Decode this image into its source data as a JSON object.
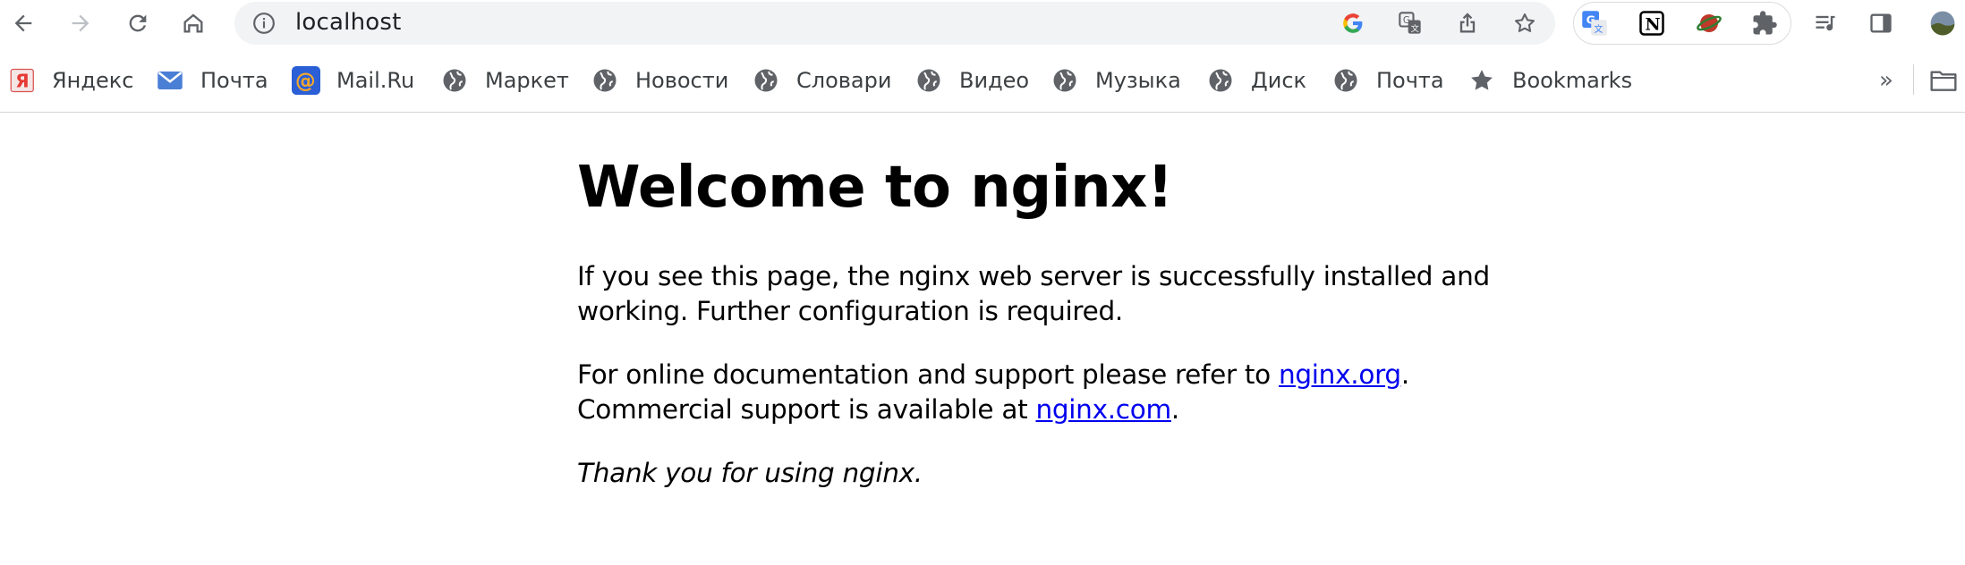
{
  "browser": {
    "url": "localhost",
    "toolbar_icons": [
      "back-icon",
      "forward-icon",
      "reload-icon",
      "home-icon"
    ],
    "omnibox_icons": [
      "site-info-icon",
      "google-icon",
      "translate-icon",
      "share-icon",
      "star-icon"
    ],
    "extensions": [
      "google-translate-icon",
      "notion-icon",
      "planet-icon",
      "puzzle-icon"
    ],
    "right_icons": [
      "reading-list-icon",
      "side-panel-icon",
      "profile-avatar"
    ]
  },
  "bookmarks": {
    "items": [
      {
        "label": "Яндекс",
        "icon": "yandex-icon"
      },
      {
        "label": "Почта",
        "icon": "mail-envelope-icon"
      },
      {
        "label": "Mail.Ru",
        "icon": "mailru-at-icon"
      },
      {
        "label": "Маркет",
        "icon": "globe-icon"
      },
      {
        "label": "Новости",
        "icon": "globe-icon"
      },
      {
        "label": "Словари",
        "icon": "globe-icon"
      },
      {
        "label": "Видео",
        "icon": "globe-icon"
      },
      {
        "label": "Музыка",
        "icon": "globe-icon"
      },
      {
        "label": "Диск",
        "icon": "globe-icon"
      },
      {
        "label": "Почта",
        "icon": "globe-icon"
      },
      {
        "label": "Bookmarks",
        "icon": "star-icon"
      }
    ],
    "overflow": "»",
    "other_folder_icon": "folder-icon"
  },
  "page": {
    "heading": "Welcome to nginx!",
    "p1": "If you see this page, the nginx web server is successfully installed and working. Further configuration is required.",
    "p2_prefix": "For online documentation and support please refer to ",
    "p2_link1": "nginx.org",
    "p2_mid": ".",
    "p2_line2": "Commercial support is available at ",
    "p2_link2": "nginx.com",
    "p2_end": ".",
    "p3": "Thank you for using nginx."
  },
  "colors": {
    "link": "#0000ee",
    "omnibox_bg": "#f1f3f4",
    "text": "#000000"
  }
}
